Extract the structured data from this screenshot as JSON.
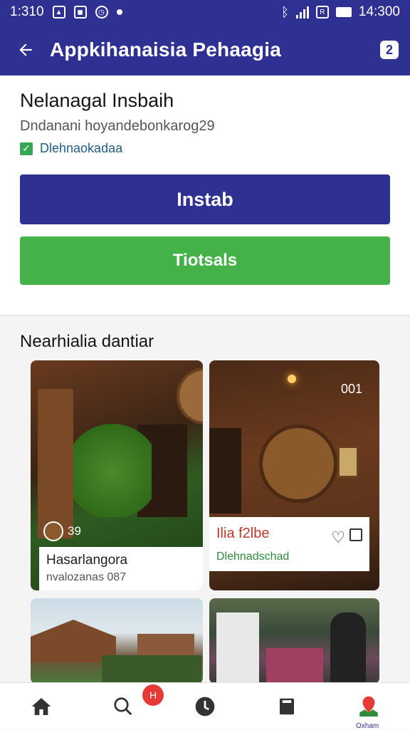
{
  "status": {
    "time": "1:310",
    "clock": "14:300"
  },
  "appbar": {
    "title": "Appkihanaisia Pehaagia",
    "help_label": "2"
  },
  "profile": {
    "name": "Nelanagal Insbaih",
    "subtitle": "Dndanani hoyandebonkarog29",
    "verified_text": "Dlehnaokadaa",
    "verified_color": "#34a853"
  },
  "buttons": {
    "primary_label": "Instab",
    "secondary_label": "Tiotsals"
  },
  "section": {
    "title": "Nearhialia dantiar"
  },
  "tiles": [
    {
      "badge": "39",
      "title": "Hasarlangora",
      "subtitle": "nvalozanas 087"
    },
    {
      "count": "001",
      "title": "Ilia f2lbe",
      "subtitle": "Dlehnadschad"
    }
  ],
  "colors": {
    "primary": "#2e3192",
    "accent_green": "#45b249",
    "badge_red": "#e53935"
  },
  "bottom_nav": {
    "items": [
      "home-icon",
      "search-icon",
      "clock-icon",
      "book-icon",
      "map-pin-icon"
    ],
    "search_badge": "H",
    "last_label": "Oxham"
  }
}
